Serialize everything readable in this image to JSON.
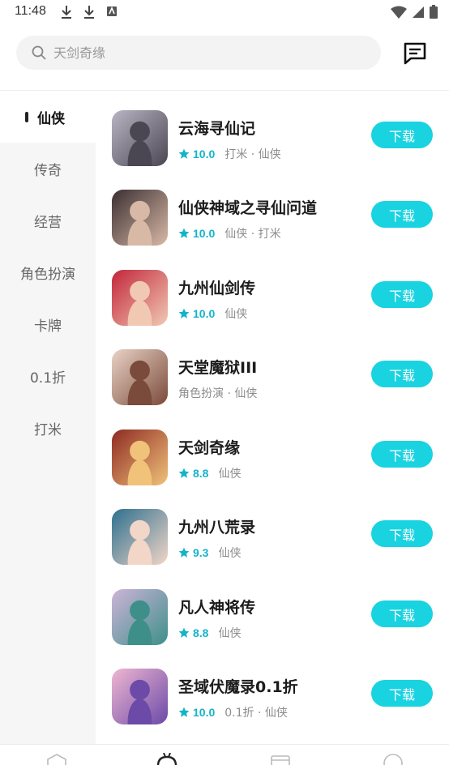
{
  "status_bar": {
    "time": "11:48"
  },
  "search": {
    "placeholder": "天剑奇缘"
  },
  "categories": [
    {
      "label": "仙侠",
      "active": true
    },
    {
      "label": "传奇",
      "active": false
    },
    {
      "label": "经营",
      "active": false
    },
    {
      "label": "角色扮演",
      "active": false
    },
    {
      "label": "卡牌",
      "active": false
    },
    {
      "label": "0.1折",
      "active": false
    },
    {
      "label": "打米",
      "active": false
    }
  ],
  "games": [
    {
      "name": "云海寻仙记",
      "rating": "10.0",
      "tags": "打米 · 仙侠",
      "action": "下载",
      "icon_colors": [
        "#b9b5c4",
        "#4a4652"
      ]
    },
    {
      "name": "仙侠神域之寻仙问道",
      "rating": "10.0",
      "tags": "仙侠 · 打米",
      "action": "下载",
      "icon_colors": [
        "#3b2f32",
        "#d8b9a6"
      ]
    },
    {
      "name": "九州仙剑传",
      "rating": "10.0",
      "tags": "仙侠",
      "action": "下载",
      "icon_colors": [
        "#c2263a",
        "#f1c9b3"
      ]
    },
    {
      "name": "天堂魔狱III",
      "rating": "",
      "tags": "角色扮演 · 仙侠",
      "action": "下载",
      "icon_colors": [
        "#e9d3c6",
        "#7a4a3a"
      ]
    },
    {
      "name": "天剑奇缘",
      "rating": "8.8",
      "tags": "仙侠",
      "action": "下载",
      "icon_colors": [
        "#8e2a22",
        "#f0c27a"
      ]
    },
    {
      "name": "九州八荒录",
      "rating": "9.3",
      "tags": "仙侠",
      "action": "下载",
      "icon_colors": [
        "#2d6f8e",
        "#f2d6c8"
      ]
    },
    {
      "name": "凡人神将传",
      "rating": "8.8",
      "tags": "仙侠",
      "action": "下载",
      "icon_colors": [
        "#cdb4d8",
        "#3e8f8a"
      ]
    },
    {
      "name": "圣域伏魔录0.1折",
      "rating": "10.0",
      "tags": "0.1折 · 仙侠",
      "action": "下载",
      "icon_colors": [
        "#f0b7d1",
        "#6b4aa8"
      ]
    }
  ],
  "colors": {
    "accent": "#19d3e0",
    "rating": "#14b4c8",
    "sidebar_bg": "#f6f6f6"
  },
  "icons": {
    "status": [
      "download-icon",
      "download-icon",
      "app-icon",
      "wifi-icon",
      "signal-icon",
      "battery-icon"
    ],
    "search": "search-icon",
    "message": "message-icon",
    "star": "star-icon",
    "bottom_nav": [
      "home-icon",
      "game-icon",
      "gift-icon",
      "profile-icon"
    ]
  }
}
